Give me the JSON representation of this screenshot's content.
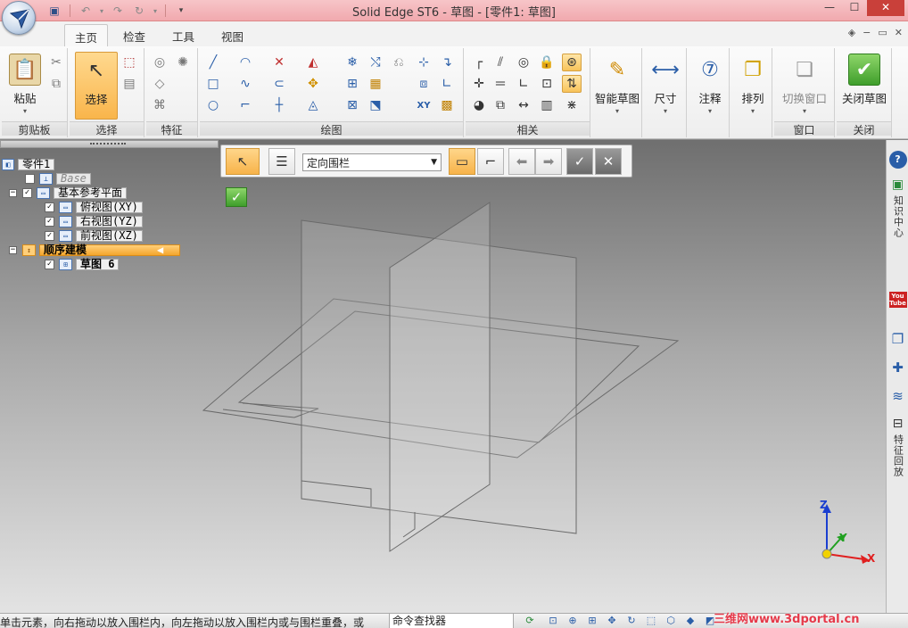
{
  "window": {
    "title": "Solid Edge ST6 - 草图 - [零件1: 草图]"
  },
  "tabs": [
    {
      "label": "主页",
      "active": true
    },
    {
      "label": "检查",
      "active": false
    },
    {
      "label": "工具",
      "active": false
    },
    {
      "label": "视图",
      "active": false
    }
  ],
  "ribbon": {
    "clipboard": {
      "paste_label": "粘贴",
      "group_label": "剪贴板"
    },
    "select": {
      "select_label": "选择",
      "group_label": "选择"
    },
    "features": {
      "group_label": "特征"
    },
    "draw": {
      "group_label": "绘图"
    },
    "relate": {
      "group_label": "相关"
    },
    "intellisketch": {
      "label": "智能草图"
    },
    "dimension": {
      "label": "尺寸"
    },
    "annotation": {
      "label": "注释"
    },
    "arrange": {
      "label": "排列"
    },
    "window": {
      "switch_label": "切换窗口",
      "group_label": "窗口"
    },
    "close": {
      "close_sketch_label": "关闭草图",
      "group_label": "关闭"
    }
  },
  "command_bar": {
    "fence_mode": "定向围栏"
  },
  "pathfinder": {
    "items": [
      {
        "label": "零件1"
      },
      {
        "label": "Base"
      },
      {
        "label": "基本参考平面"
      },
      {
        "label": "俯视图(XY)"
      },
      {
        "label": "右视图(YZ)"
      },
      {
        "label": "前视图(XZ)"
      },
      {
        "label": "顺序建模"
      },
      {
        "label": "草图 6"
      }
    ]
  },
  "triad": {
    "x": "X",
    "y": "Y",
    "z": "Z"
  },
  "right_strip": {
    "knowledge_center": "知识中心",
    "youtube": "You Tube",
    "feature_playback": "特征回放"
  },
  "status": {
    "message": "单击元素，向右拖动以放入围栏内，向左拖动以放入围栏内或与围栏重叠，或",
    "command_finder": "命令查找器",
    "watermark": "三维网www.3dportal.cn"
  },
  "colors": {
    "title_bar": "#f1a9ae",
    "selected_button": "#f9b54b",
    "sequential_node": "#f5a62c",
    "close_sketch_green": "#3f9e2b",
    "axis_x": "#e02020",
    "axis_y": "#20a020",
    "axis_z": "#1a3fd0"
  }
}
